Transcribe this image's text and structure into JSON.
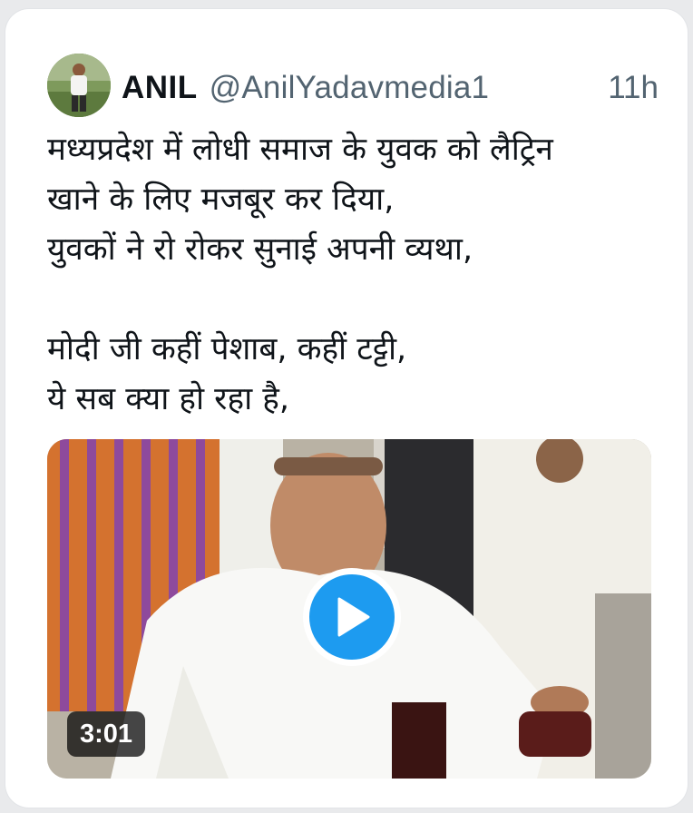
{
  "tweet": {
    "author_name": "ANIL",
    "handle": "@AnilYadavmedia1",
    "timestamp": "11h",
    "text": "मध्यप्रदेश में लोधी समाज के युवक को लैट्रिन\nखाने के लिए मजबूर कर दिया,\nयुवकों ने रो रोकर सुनाई अपनी व्यथा,\n\nमोदी जी कहीं पेशाब, कहीं टट्टी,\nये सब क्या हो रहा है,",
    "media": {
      "type": "video",
      "duration": "3:01",
      "play_icon": "play-icon"
    }
  },
  "colors": {
    "text_primary": "#0f1419",
    "text_secondary": "#536471",
    "accent": "#1d9bf0",
    "card_background": "#ffffff"
  }
}
